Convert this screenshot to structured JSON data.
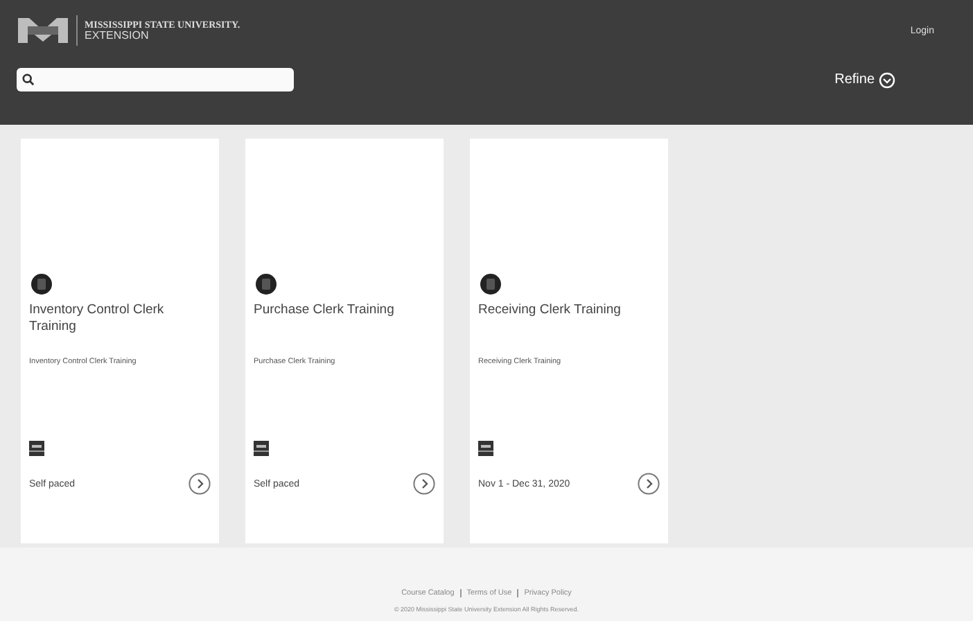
{
  "header": {
    "logo_title": "MISSISSIPPI STATE UNIVERSITY.",
    "logo_subtitle": "EXTENSION",
    "login": "Login",
    "refine": "Refine"
  },
  "courses": [
    {
      "title": "Inventory Control Clerk Training",
      "description": "Inventory Control Clerk Training",
      "schedule": "Self paced"
    },
    {
      "title": "Purchase Clerk Training",
      "description": "Purchase Clerk Training",
      "schedule": "Self paced"
    },
    {
      "title": "Receiving Clerk Training",
      "description": "Receiving Clerk Training",
      "schedule": "Nov 1 - Dec 31, 2020"
    }
  ],
  "footer": {
    "links": [
      "Course Catalog",
      "Terms of Use",
      "Privacy Policy"
    ],
    "copyright": "© 2020 Mississippi State University Extension All Rights Reserved."
  }
}
